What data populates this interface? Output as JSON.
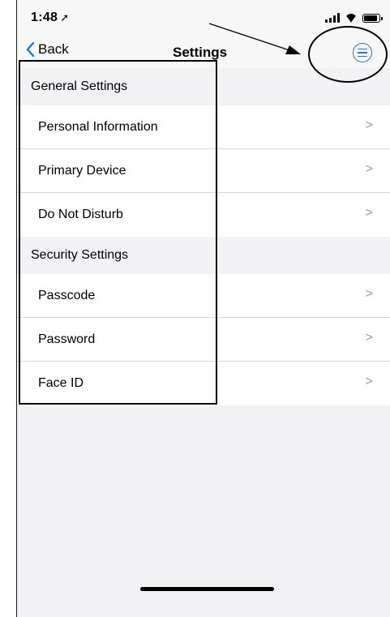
{
  "status_bar": {
    "time": "1:48",
    "location_icon": "location-arrow-icon",
    "signal_icon": "signal-icon",
    "wifi_icon": "wifi-icon",
    "battery_icon": "battery-icon"
  },
  "nav": {
    "back_label": "Back",
    "back_icon": "chevron-left-icon",
    "title": "Settings",
    "menu_icon": "menu-icon",
    "accent_color": "#2a73d8"
  },
  "sections": [
    {
      "header": "General Settings",
      "items": [
        {
          "label": "Personal Information",
          "chevron": ">"
        },
        {
          "label": "Primary Device",
          "chevron": ">"
        },
        {
          "label": "Do Not Disturb",
          "chevron": ">"
        }
      ]
    },
    {
      "header": "Security Settings",
      "items": [
        {
          "label": "Passcode",
          "chevron": ">"
        },
        {
          "label": "Password",
          "chevron": ">"
        },
        {
          "label": "Face ID",
          "chevron": ">"
        }
      ]
    }
  ],
  "colors": {
    "background": "#f2f2f4",
    "row_background": "#ffffff",
    "chevron": "#9a9aa0"
  }
}
